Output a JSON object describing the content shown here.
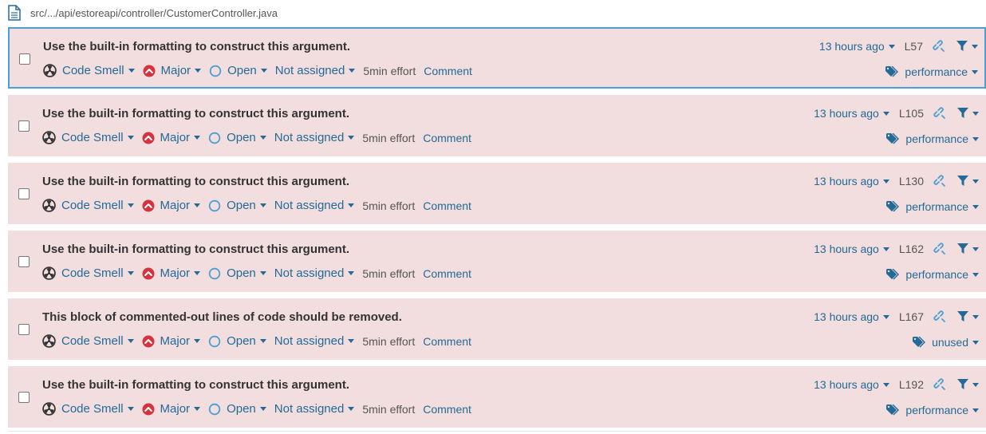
{
  "file": {
    "path": "src/.../api/estoreapi/controller/CustomerController.java"
  },
  "issues": [
    {
      "message": "Use the built-in formatting to construct this argument.",
      "type": "Code Smell",
      "severity": "Major",
      "status": "Open",
      "assignee": "Not assigned",
      "effort": "5min effort",
      "comment": "Comment",
      "date": "13 hours ago",
      "line": "L57",
      "tag": "performance",
      "selected": true
    },
    {
      "message": "Use the built-in formatting to construct this argument.",
      "type": "Code Smell",
      "severity": "Major",
      "status": "Open",
      "assignee": "Not assigned",
      "effort": "5min effort",
      "comment": "Comment",
      "date": "13 hours ago",
      "line": "L105",
      "tag": "performance",
      "selected": false
    },
    {
      "message": "Use the built-in formatting to construct this argument.",
      "type": "Code Smell",
      "severity": "Major",
      "status": "Open",
      "assignee": "Not assigned",
      "effort": "5min effort",
      "comment": "Comment",
      "date": "13 hours ago",
      "line": "L130",
      "tag": "performance",
      "selected": false
    },
    {
      "message": "Use the built-in formatting to construct this argument.",
      "type": "Code Smell",
      "severity": "Major",
      "status": "Open",
      "assignee": "Not assigned",
      "effort": "5min effort",
      "comment": "Comment",
      "date": "13 hours ago",
      "line": "L162",
      "tag": "performance",
      "selected": false
    },
    {
      "message": "This block of commented-out lines of code should be removed.",
      "type": "Code Smell",
      "severity": "Major",
      "status": "Open",
      "assignee": "Not assigned",
      "effort": "5min effort",
      "comment": "Comment",
      "date": "13 hours ago",
      "line": "L167",
      "tag": "unused",
      "selected": false
    },
    {
      "message": "Use the built-in formatting to construct this argument.",
      "type": "Code Smell",
      "severity": "Major",
      "status": "Open",
      "assignee": "Not assigned",
      "effort": "5min effort",
      "comment": "Comment",
      "date": "13 hours ago",
      "line": "L192",
      "tag": "performance",
      "selected": false
    }
  ],
  "icons": {
    "file": "file-document-icon",
    "type": "code-smell-icon",
    "severity": "severity-major-icon",
    "status": "status-open-icon",
    "link": "permalink-icon",
    "filter": "filter-icon",
    "tag": "tag-icon"
  },
  "colors": {
    "issue_bg": "#f2dede",
    "selected_border": "#4b9fd5",
    "link": "#236a97",
    "major": "#d4333f",
    "open": "#4b9fd5"
  }
}
